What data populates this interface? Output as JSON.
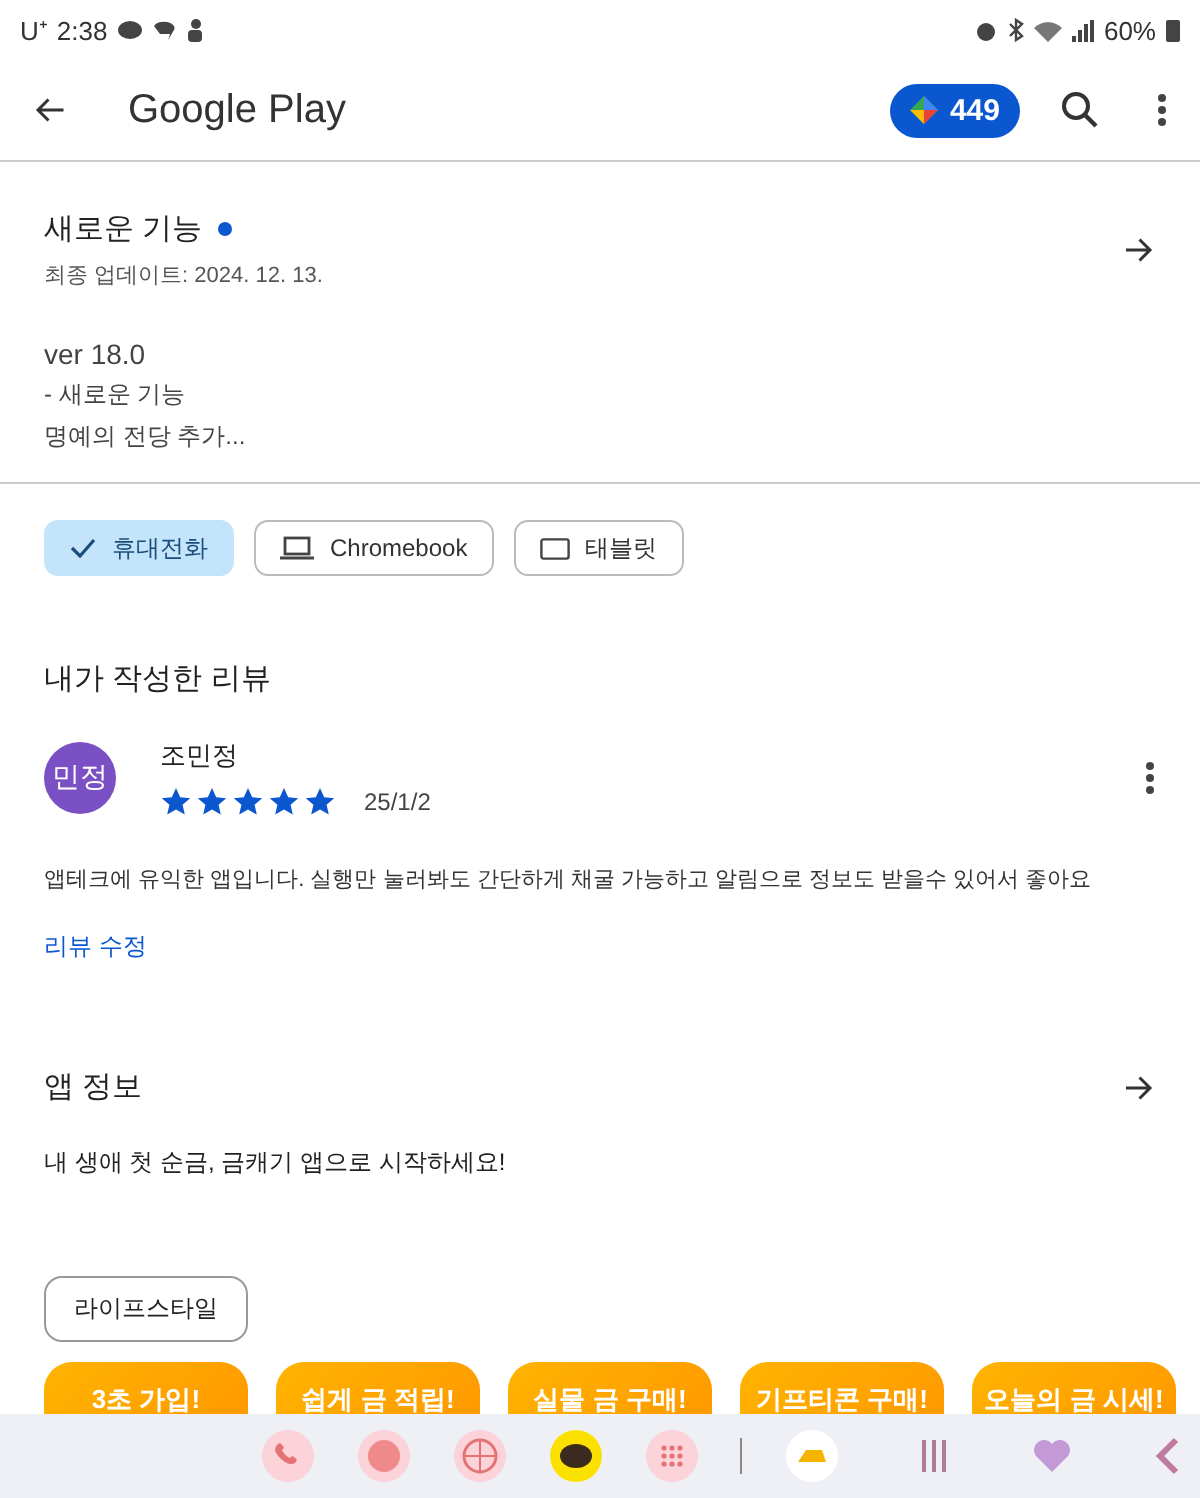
{
  "status_bar": {
    "carrier": "U⁺",
    "time": "2:38",
    "battery": "60%"
  },
  "app_bar": {
    "title": "Google Play",
    "points": "449"
  },
  "whats_new": {
    "title": "새로운 기능",
    "unread": true,
    "updated": "최종 업데이트: 2024. 12. 13.",
    "lines": [
      "ver 18.0",
      "- 새로운 기능",
      "명예의 전당 추가..."
    ]
  },
  "device_chips": [
    {
      "label": "휴대전화",
      "selected": true
    },
    {
      "label": "Chromebook",
      "kind": "laptop",
      "selected": false
    },
    {
      "label": "태블릿",
      "kind": "tablet",
      "selected": false
    }
  ],
  "my_review": {
    "title": "내가 작성한 리뷰",
    "avatar": "민정",
    "author": "조민정",
    "stars": 5,
    "date": "25/1/2",
    "text": "앱테크에 유익한 앱입니다. 실행만 눌러봐도 간단하게 채굴 가능하고 알림으로 정보도 받을수 있어서 좋아요",
    "edit_link": "리뷰 수정"
  },
  "app_info": {
    "title": "앱 정보",
    "description": "내 생애 첫 순금, 금캐기 앱으로 시작하세요!",
    "category": "라이프스타일"
  },
  "screenshots": [
    {
      "title": "3초 가입!"
    },
    {
      "title": "쉽게 금 적립!"
    },
    {
      "title": "실물 금 구매!"
    },
    {
      "title": "기프티콘 구매!"
    },
    {
      "title": "오늘의 금 시세!"
    }
  ]
}
